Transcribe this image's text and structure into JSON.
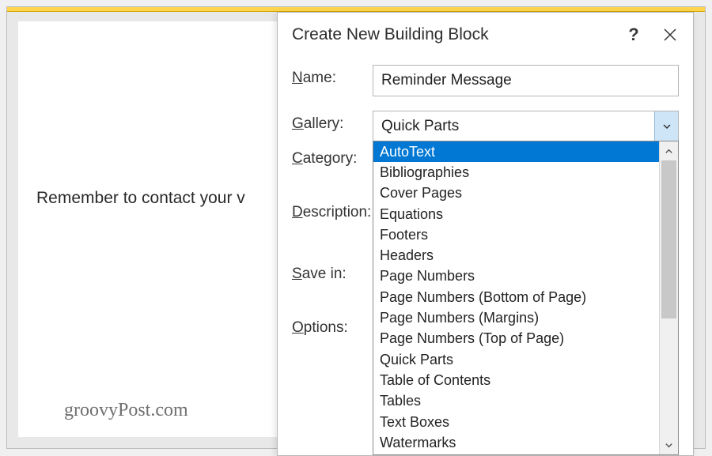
{
  "document": {
    "body_text": "Remember to contact your v",
    "watermark": "groovyPost.com"
  },
  "dialog": {
    "title": "Create New Building Block",
    "labels": {
      "name": "ame:",
      "name_u": "N",
      "gallery": "allery:",
      "gallery_u": "G",
      "category": "ategory:",
      "category_u": "C",
      "description": "escription:",
      "description_u": "D",
      "save_in": "ave in:",
      "save_in_u": "S",
      "options": "ptions:",
      "options_u": "O"
    },
    "name_value": "Reminder Message",
    "gallery_value": "Quick Parts",
    "gallery_options": [
      "AutoText",
      "Bibliographies",
      "Cover Pages",
      "Equations",
      "Footers",
      "Headers",
      "Page Numbers",
      "Page Numbers (Bottom of Page)",
      "Page Numbers (Margins)",
      "Page Numbers (Top of Page)",
      "Quick Parts",
      "Table of Contents",
      "Tables",
      "Text Boxes",
      "Watermarks"
    ],
    "gallery_selected_index": 0
  }
}
